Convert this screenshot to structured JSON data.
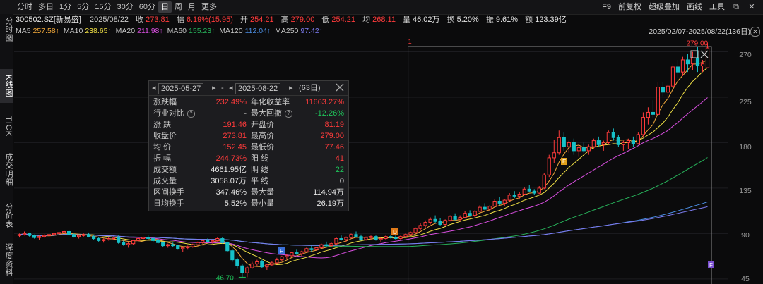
{
  "toolbar": {
    "periods": [
      "分时",
      "多日",
      "1分",
      "5分",
      "15分",
      "30分",
      "60分",
      "日",
      "周",
      "月",
      "更多"
    ],
    "active_period": "日",
    "tools": [
      "F9",
      "前复权",
      "超级叠加",
      "画线",
      "工具"
    ]
  },
  "left_tabs": [
    "分时图",
    "K线图",
    "TICK",
    "成交明细",
    "分价表",
    "深度资料"
  ],
  "quote": {
    "code": "300502.SZ[新易盛]",
    "date": "2025/08/22",
    "close_label": "收",
    "close": "273.81",
    "change_label": "幅",
    "change": "6.19%(15.95)",
    "open_label": "开",
    "open": "254.21",
    "high_label": "高",
    "high": "279.00",
    "low_label": "低",
    "low": "254.21",
    "avg_label": "均",
    "avg": "268.11",
    "volume_label": "量",
    "volume": "46.02万",
    "turnover_label": "换",
    "turnover": "5.20%",
    "amplitude_label": "振",
    "amplitude": "9.61%",
    "amount_label": "额",
    "amount": "123.39亿"
  },
  "ma": [
    {
      "name": "MA5",
      "value": "257.58↑",
      "color": "#f2a93b"
    },
    {
      "name": "MA10",
      "value": "238.65↑",
      "color": "#f0e045"
    },
    {
      "name": "MA20",
      "value": "211.98↑",
      "color": "#d94fe0"
    },
    {
      "name": "MA60",
      "value": "155.23↑",
      "color": "#27b15a"
    },
    {
      "name": "MA120",
      "value": "112.04↑",
      "color": "#4a8ce0"
    },
    {
      "name": "MA250",
      "value": "97.42↑",
      "color": "#7c7cf0"
    }
  ],
  "range_label": "2025/02/07-2025/08/22(136日)",
  "y_ticks": [
    "270",
    "225",
    "180",
    "135",
    "90",
    "45"
  ],
  "marks": {
    "max_label": "279.00",
    "min_label": "46.70",
    "sel_top_marker": "1"
  },
  "popup": {
    "start_date": "2025-05-27",
    "dash": "-",
    "end_date": "2025-08-22",
    "days": "(63日)",
    "rows": [
      {
        "l1": "涨跌幅",
        "v1": "232.49%",
        "c1": "red",
        "l2": "年化收益率",
        "v2": "11663.27%",
        "c2": "red"
      },
      {
        "l1": "行业对比",
        "v1": "-",
        "c1": "white",
        "l2": "最大回撤",
        "v2": "-12.26%",
        "c2": "green"
      },
      {
        "l1": "涨  跌",
        "v1": "191.46",
        "c1": "red",
        "l2": "开盘价",
        "v2": "81.19",
        "c2": "red"
      },
      {
        "l1": "收盘价",
        "v1": "273.81",
        "c1": "red",
        "l2": "最高价",
        "v2": "279.00",
        "c2": "red"
      },
      {
        "l1": "均  价",
        "v1": "152.45",
        "c1": "red",
        "l2": "最低价",
        "v2": "77.46",
        "c2": "red"
      },
      {
        "l1": "振  幅",
        "v1": "244.73%",
        "c1": "red",
        "l2": "阳  线",
        "v2": "41",
        "c2": "red"
      },
      {
        "l1": "成交额",
        "v1": "4661.95亿",
        "c1": "white",
        "l2": "阴  线",
        "v2": "22",
        "c2": "green"
      },
      {
        "l1": "成交量",
        "v1": "3058.07万",
        "c1": "white",
        "l2": "平  线",
        "v2": "0",
        "c2": "white"
      },
      {
        "l1": "区间换手",
        "v1": "347.46%",
        "c1": "white",
        "l2": "最大量",
        "v2": "114.94万",
        "c2": "white"
      },
      {
        "l1": "日均换手",
        "v1": "5.52%",
        "c1": "white",
        "l2": "最小量",
        "v2": "26.19万",
        "c2": "white"
      }
    ]
  },
  "chart_data": {
    "type": "candlestick",
    "y_range": [
      40,
      285
    ],
    "colors": {
      "up": "#ff3b3b",
      "down": "#16c0c8",
      "bg": "#0b0b0c"
    },
    "candles_ohlc": [
      [
        88,
        90,
        86,
        89
      ],
      [
        89,
        92,
        88,
        90
      ],
      [
        90,
        91,
        87,
        88
      ],
      [
        88,
        89,
        85,
        86
      ],
      [
        86,
        88,
        84,
        87
      ],
      [
        87,
        89,
        86,
        88
      ],
      [
        88,
        90,
        87,
        89
      ],
      [
        89,
        91,
        88,
        90
      ],
      [
        90,
        92,
        89,
        91
      ],
      [
        91,
        93,
        90,
        92
      ],
      [
        92,
        93,
        88,
        89
      ],
      [
        89,
        90,
        86,
        87
      ],
      [
        87,
        89,
        85,
        88
      ],
      [
        88,
        90,
        87,
        89
      ],
      [
        89,
        91,
        86,
        87
      ],
      [
        87,
        88,
        84,
        85
      ],
      [
        85,
        86,
        82,
        83
      ],
      [
        83,
        85,
        81,
        84
      ],
      [
        84,
        86,
        83,
        85
      ],
      [
        85,
        87,
        84,
        86
      ],
      [
        86,
        88,
        80,
        81
      ],
      [
        81,
        83,
        78,
        79
      ],
      [
        79,
        82,
        76,
        80
      ],
      [
        80,
        84,
        79,
        83
      ],
      [
        83,
        86,
        82,
        85
      ],
      [
        85,
        87,
        84,
        86
      ],
      [
        86,
        88,
        84,
        85
      ],
      [
        85,
        86,
        82,
        83
      ],
      [
        83,
        85,
        80,
        81
      ],
      [
        81,
        82,
        77,
        78
      ],
      [
        78,
        80,
        76,
        79
      ],
      [
        79,
        81,
        77,
        78
      ],
      [
        78,
        79,
        74,
        75
      ],
      [
        75,
        77,
        72,
        76
      ],
      [
        76,
        78,
        74,
        77
      ],
      [
        77,
        80,
        76,
        79
      ],
      [
        79,
        82,
        78,
        81
      ],
      [
        81,
        84,
        80,
        83
      ],
      [
        83,
        85,
        81,
        82
      ],
      [
        82,
        84,
        80,
        83
      ],
      [
        83,
        86,
        82,
        85
      ],
      [
        85,
        86,
        80,
        81
      ],
      [
        81,
        82,
        72,
        73
      ],
      [
        73,
        74,
        62,
        64
      ],
      [
        64,
        66,
        55,
        58
      ],
      [
        58,
        60,
        47,
        51
      ],
      [
        51,
        58,
        46.7,
        56
      ],
      [
        56,
        62,
        55,
        60
      ],
      [
        60,
        64,
        58,
        62
      ],
      [
        62,
        64,
        56,
        57
      ],
      [
        57,
        60,
        54,
        59
      ],
      [
        59,
        63,
        58,
        61
      ],
      [
        61,
        66,
        60,
        64
      ],
      [
        64,
        68,
        63,
        67
      ],
      [
        67,
        70,
        65,
        68
      ],
      [
        68,
        72,
        67,
        71
      ],
      [
        71,
        74,
        69,
        70
      ],
      [
        70,
        73,
        68,
        72
      ],
      [
        72,
        76,
        71,
        75
      ],
      [
        75,
        78,
        72,
        74
      ],
      [
        74,
        77,
        73,
        76
      ],
      [
        76,
        80,
        75,
        79
      ],
      [
        79,
        82,
        77,
        78
      ],
      [
        78,
        81,
        77,
        80
      ],
      [
        80,
        86,
        79,
        85
      ],
      [
        85,
        88,
        83,
        84
      ],
      [
        84,
        87,
        82,
        86
      ],
      [
        86,
        90,
        85,
        89
      ],
      [
        89,
        92,
        86,
        87
      ],
      [
        87,
        89,
        83,
        84
      ],
      [
        84,
        87,
        83,
        86
      ],
      [
        86,
        88,
        84,
        87
      ],
      [
        87,
        88,
        83,
        84
      ],
      [
        84,
        86,
        82,
        85
      ],
      [
        85,
        88,
        84,
        87
      ],
      [
        87,
        89,
        85,
        86
      ],
      [
        86,
        88,
        84,
        85
      ],
      [
        85,
        88,
        84,
        87
      ],
      [
        87,
        90,
        86,
        89
      ],
      [
        89,
        92,
        88,
        91
      ],
      [
        91,
        96,
        90,
        95
      ],
      [
        95,
        100,
        93,
        98
      ],
      [
        98,
        103,
        96,
        101
      ],
      [
        101,
        106,
        99,
        104
      ],
      [
        104,
        108,
        100,
        102
      ],
      [
        102,
        105,
        98,
        99
      ],
      [
        99,
        104,
        98,
        103
      ],
      [
        103,
        108,
        102,
        107
      ],
      [
        107,
        110,
        103,
        104
      ],
      [
        104,
        108,
        102,
        106
      ],
      [
        106,
        112,
        105,
        110
      ],
      [
        110,
        113,
        107,
        108
      ],
      [
        108,
        113,
        106,
        112
      ],
      [
        112,
        118,
        111,
        116
      ],
      [
        116,
        120,
        113,
        114
      ],
      [
        114,
        118,
        112,
        117
      ],
      [
        117,
        124,
        116,
        122
      ],
      [
        122,
        126,
        118,
        120
      ],
      [
        120,
        124,
        117,
        123
      ],
      [
        123,
        130,
        122,
        128
      ],
      [
        128,
        132,
        125,
        127
      ],
      [
        127,
        131,
        124,
        129
      ],
      [
        129,
        136,
        128,
        134
      ],
      [
        134,
        138,
        131,
        132
      ],
      [
        132,
        134,
        128,
        130
      ],
      [
        130,
        137,
        129,
        135
      ],
      [
        135,
        150,
        134,
        148
      ],
      [
        148,
        168,
        146,
        165
      ],
      [
        165,
        183,
        160,
        170
      ],
      [
        170,
        192,
        168,
        185
      ],
      [
        185,
        190,
        172,
        176
      ],
      [
        176,
        182,
        170,
        180
      ],
      [
        180,
        184,
        168,
        172
      ],
      [
        172,
        178,
        166,
        175
      ],
      [
        175,
        180,
        170,
        172
      ],
      [
        172,
        178,
        168,
        176
      ],
      [
        176,
        184,
        174,
        182
      ],
      [
        182,
        186,
        176,
        178
      ],
      [
        178,
        182,
        172,
        180
      ],
      [
        180,
        192,
        178,
        190
      ],
      [
        190,
        194,
        182,
        185
      ],
      [
        185,
        188,
        176,
        178
      ],
      [
        178,
        182,
        172,
        180
      ],
      [
        180,
        184,
        174,
        182
      ],
      [
        182,
        186,
        176,
        179
      ],
      [
        179,
        190,
        178,
        188
      ],
      [
        188,
        210,
        186,
        205
      ],
      [
        205,
        215,
        198,
        210
      ],
      [
        210,
        222,
        205,
        208
      ],
      [
        208,
        240,
        206,
        235
      ],
      [
        235,
        240,
        226,
        230
      ],
      [
        230,
        238,
        222,
        236
      ],
      [
        236,
        258,
        234,
        255
      ],
      [
        255,
        262,
        244,
        250
      ],
      [
        250,
        265,
        246,
        262
      ],
      [
        262,
        268,
        250,
        258
      ],
      [
        258,
        270,
        252,
        264
      ],
      [
        264,
        275,
        250,
        256
      ],
      [
        256,
        262,
        250,
        258
      ],
      [
        254.21,
        279,
        254.21,
        273.81
      ]
    ],
    "ma_last": {
      "MA5": 257.58,
      "MA10": 238.65,
      "MA20": 211.98,
      "MA60": 155.23,
      "MA120": 112.04,
      "MA250": 97.42
    },
    "selection": {
      "start_index": 79,
      "end_index": 139
    }
  }
}
